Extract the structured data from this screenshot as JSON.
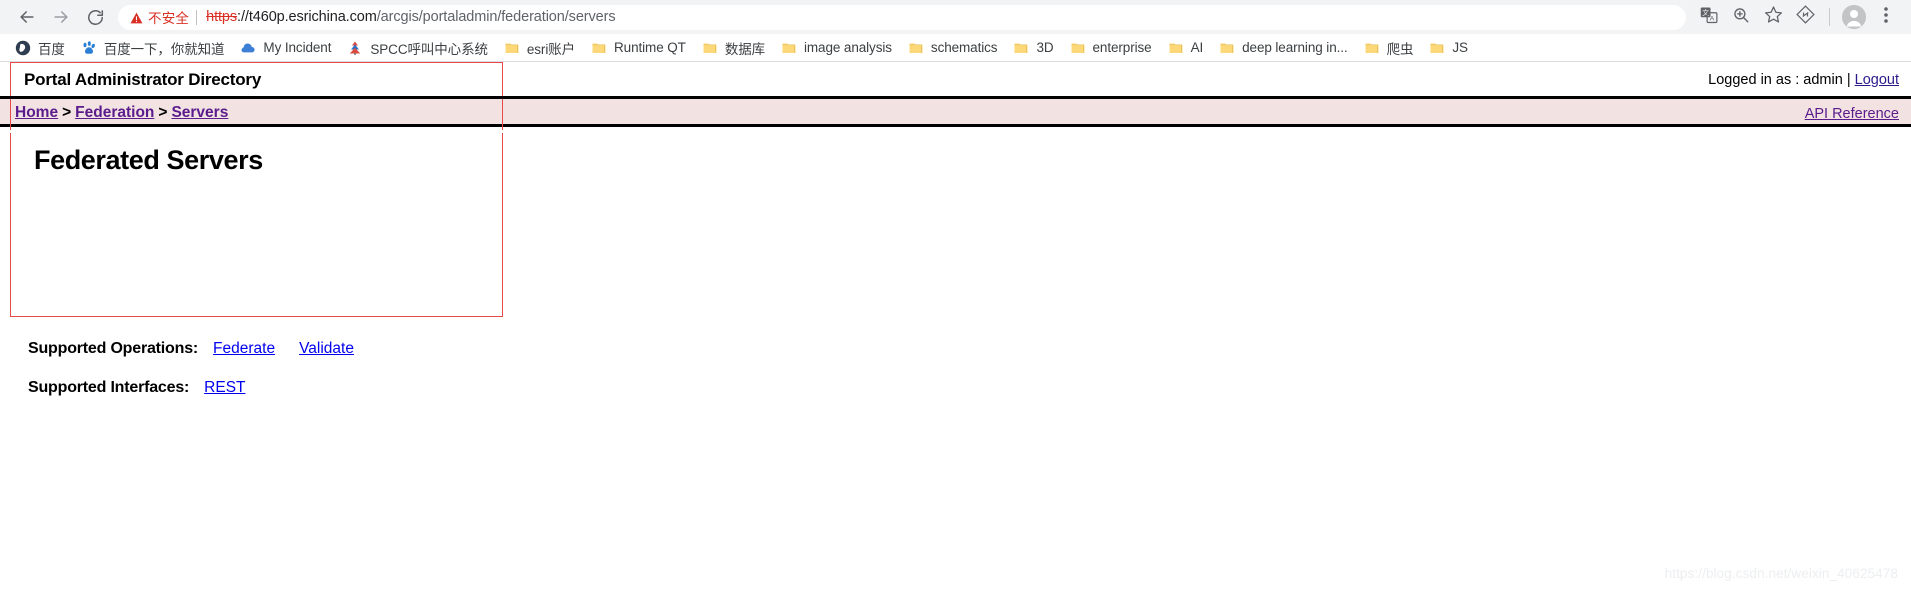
{
  "browser": {
    "nav": {
      "back_icon": "arrow-left-icon",
      "forward_icon": "arrow-right-icon",
      "reload_icon": "reload-icon"
    },
    "omnibox": {
      "security_icon": "warning-triangle-icon",
      "security_label": "不安全",
      "url_scheme": "https",
      "url_scheme_suffix": "://",
      "url_host": "t460p.esrichina.com",
      "url_path": "/arcgis/portaladmin/federation/servers",
      "full_url": "https://t460p.esrichina.com/arcgis/portaladmin/federation/servers"
    },
    "toolbar_icons": [
      {
        "name": "translate-icon"
      },
      {
        "name": "zoom-search-icon"
      },
      {
        "name": "bookmark-star-icon"
      },
      {
        "name": "extension-icon"
      },
      {
        "name": "profile-avatar-icon"
      },
      {
        "name": "more-menu-icon"
      }
    ],
    "bookmarks": [
      {
        "label": "百度",
        "icon": "baidu-globe-icon"
      },
      {
        "label": "百度一下，你就知道",
        "icon": "baidu-paw-icon"
      },
      {
        "label": "My Incident",
        "icon": "cloud-icon"
      },
      {
        "label": "SPCC呼叫中心系统",
        "icon": "tree-icon"
      },
      {
        "label": "esri账户",
        "icon": "folder-icon"
      },
      {
        "label": "Runtime QT",
        "icon": "folder-icon"
      },
      {
        "label": "数据库",
        "icon": "folder-icon"
      },
      {
        "label": "image analysis",
        "icon": "folder-icon"
      },
      {
        "label": "schematics",
        "icon": "folder-icon"
      },
      {
        "label": "3D",
        "icon": "folder-icon"
      },
      {
        "label": "enterprise",
        "icon": "folder-icon"
      },
      {
        "label": "AI",
        "icon": "folder-icon"
      },
      {
        "label": "deep learning in...",
        "icon": "folder-icon"
      },
      {
        "label": "爬虫",
        "icon": "folder-icon"
      },
      {
        "label": "JS",
        "icon": "folder-icon"
      }
    ]
  },
  "page": {
    "app_title": "Portal Administrator Directory",
    "session": {
      "logged_in_text": "Logged in as : admin",
      "separator": "|",
      "logout_label": "Logout"
    },
    "breadcrumb": {
      "items": [
        {
          "label": "Home"
        },
        {
          "label": "Federation"
        },
        {
          "label": "Servers"
        }
      ],
      "separator": ">"
    },
    "api_reference_label": "API Reference",
    "heading": "Federated Servers",
    "supported_operations": {
      "label": "Supported Operations:",
      "links": [
        {
          "label": "Federate"
        },
        {
          "label": "Validate"
        }
      ]
    },
    "supported_interfaces": {
      "label": "Supported Interfaces:",
      "links": [
        {
          "label": "REST"
        }
      ]
    },
    "watermark": "https://blog.csdn.net/weixin_40625478",
    "colors": {
      "breadcrumb_band": "#f2e2e2",
      "frame_red": "#e84a4a",
      "link_purple": "#5a1b8c",
      "link_blue": "#0000ee",
      "insecure_red": "#d93025"
    }
  }
}
